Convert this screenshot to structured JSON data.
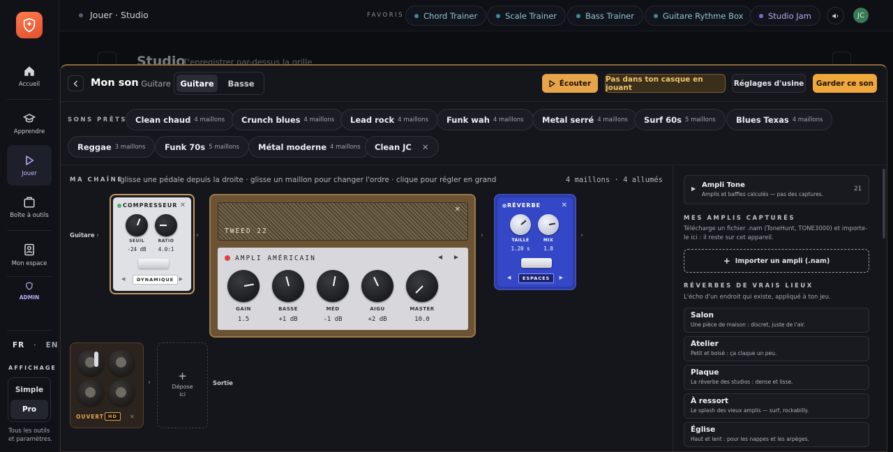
{
  "sidebar": {
    "items": [
      {
        "label": "Accueil",
        "icon": "home-icon"
      },
      {
        "label": "Apprendre",
        "icon": "graduation-icon"
      },
      {
        "label": "Jouer",
        "icon": "play-icon"
      },
      {
        "label": "Boîte à outils",
        "icon": "toolbox-icon"
      },
      {
        "label": "Mon espace",
        "icon": "profile-icon"
      },
      {
        "label": "ADMIN",
        "icon": "shield-icon"
      }
    ],
    "lang_fr": "FR",
    "lang_sep": "·",
    "lang_en": "EN",
    "display_label": "AFFICHAGE",
    "mode_simple": "Simple",
    "mode_pro": "Pro",
    "tools_note": "Tous les outils et paramètres."
  },
  "topbar": {
    "breadcrumb": "Jouer · Studio",
    "favorites_label": "FAVORIS",
    "favorites": [
      "Chord Trainer",
      "Scale Trainer",
      "Bass Trainer",
      "Guitare Rythme Box",
      "Studio Jam"
    ],
    "avatar": "JC"
  },
  "background_header": {
    "title": "Studio",
    "subtitle": "T'enregistrer par-dessus la grille"
  },
  "panel": {
    "title": "Mon son",
    "subtitle": "· Guitare",
    "tabs": [
      "Guitare",
      "Basse"
    ],
    "active_tab": "Guitare",
    "listen": "Écouter",
    "no_headphones": "Pas dans ton casque en jouant",
    "factory": "Réglages d'usine",
    "keep": "Garder ce son",
    "colors": {
      "accent": "#e8a449",
      "keep": "#f0a73c"
    }
  },
  "presets": {
    "label": "SONS PRÊTS",
    "items": [
      {
        "name": "Clean chaud",
        "count": "4 maillons"
      },
      {
        "name": "Crunch blues",
        "count": "4 maillons"
      },
      {
        "name": "Lead rock",
        "count": "4 maillons"
      },
      {
        "name": "Funk wah",
        "count": "4 maillons"
      },
      {
        "name": "Metal serré",
        "count": "4 maillons"
      },
      {
        "name": "Surf 60s",
        "count": "5 maillons"
      },
      {
        "name": "Blues Texas",
        "count": "4 maillons"
      },
      {
        "name": "Reggae",
        "count": "3 maillons"
      },
      {
        "name": "Funk 70s",
        "count": "5 maillons"
      },
      {
        "name": "Métal moderne",
        "count": "4 maillons"
      },
      {
        "name": "Clean JC",
        "count": ""
      }
    ]
  },
  "chain": {
    "label": "MA CHAÎNE",
    "hint": "glisse une pédale depuis la droite · glisse un maillon pour changer l'ordre · clique pour régler en grand",
    "status": "4 maillons · 4 allumés",
    "input_label": "Guitare",
    "output_label": "Sortie",
    "drop_label": "Dépose ici",
    "compressor": {
      "name": "COMPRESSEUR",
      "knobs": [
        {
          "label": "SEUIL",
          "value": "-24 dB"
        },
        {
          "label": "RATIO",
          "value": "4.0:1"
        }
      ],
      "mode": "DYNAMIQUE"
    },
    "amp": {
      "cab_name": "TWEED 22",
      "model": "AMPLI AMÉRICAIN",
      "knobs": [
        {
          "label": "GAIN",
          "value": "1.5"
        },
        {
          "label": "BASSE",
          "value": "+1 dB"
        },
        {
          "label": "MÉD",
          "value": "-1 dB"
        },
        {
          "label": "AIGU",
          "value": "+2 dB"
        },
        {
          "label": "MASTER",
          "value": "10.0"
        }
      ]
    },
    "reverb": {
      "name": "RÉVERBE",
      "knobs": [
        {
          "label": "TAILLE",
          "value": "1.20 s"
        },
        {
          "label": "MIX",
          "value": "1.8"
        }
      ],
      "mode": "ESPACES"
    },
    "looper": {
      "state": "OUVERT",
      "badge": "HD"
    }
  },
  "right": {
    "amp_tone": {
      "title": "Ampli Tone",
      "desc": "Amplis et baffles calculés — pas des captures.",
      "count": "21"
    },
    "captured_label": "MES AMPLIS CAPTURÉS",
    "captured_note": "Télécharge un fichier .nam (TonеHunt, TONE3000) et importe-le ici : il reste sur cet appareil.",
    "import_button": "Importer un ampli (.nam)",
    "reverbs_label": "RÉVERBES DE VRAIS LIEUX",
    "reverbs_note": "L'écho d'un endroit qui existe, appliqué à ton jeu.",
    "rooms": [
      {
        "name": "Salon",
        "desc": "Une pièce de maison : discret, juste de l'air."
      },
      {
        "name": "Atelier",
        "desc": "Petit et boisé : ça claque un peu."
      },
      {
        "name": "Plaque",
        "desc": "La réverbe des studios : dense et lisse."
      },
      {
        "name": "À ressort",
        "desc": "Le splash des vieux amplis — surf, rockabilly."
      },
      {
        "name": "Église",
        "desc": "Haut et lent : pour les nappes et les arpèges."
      }
    ]
  }
}
